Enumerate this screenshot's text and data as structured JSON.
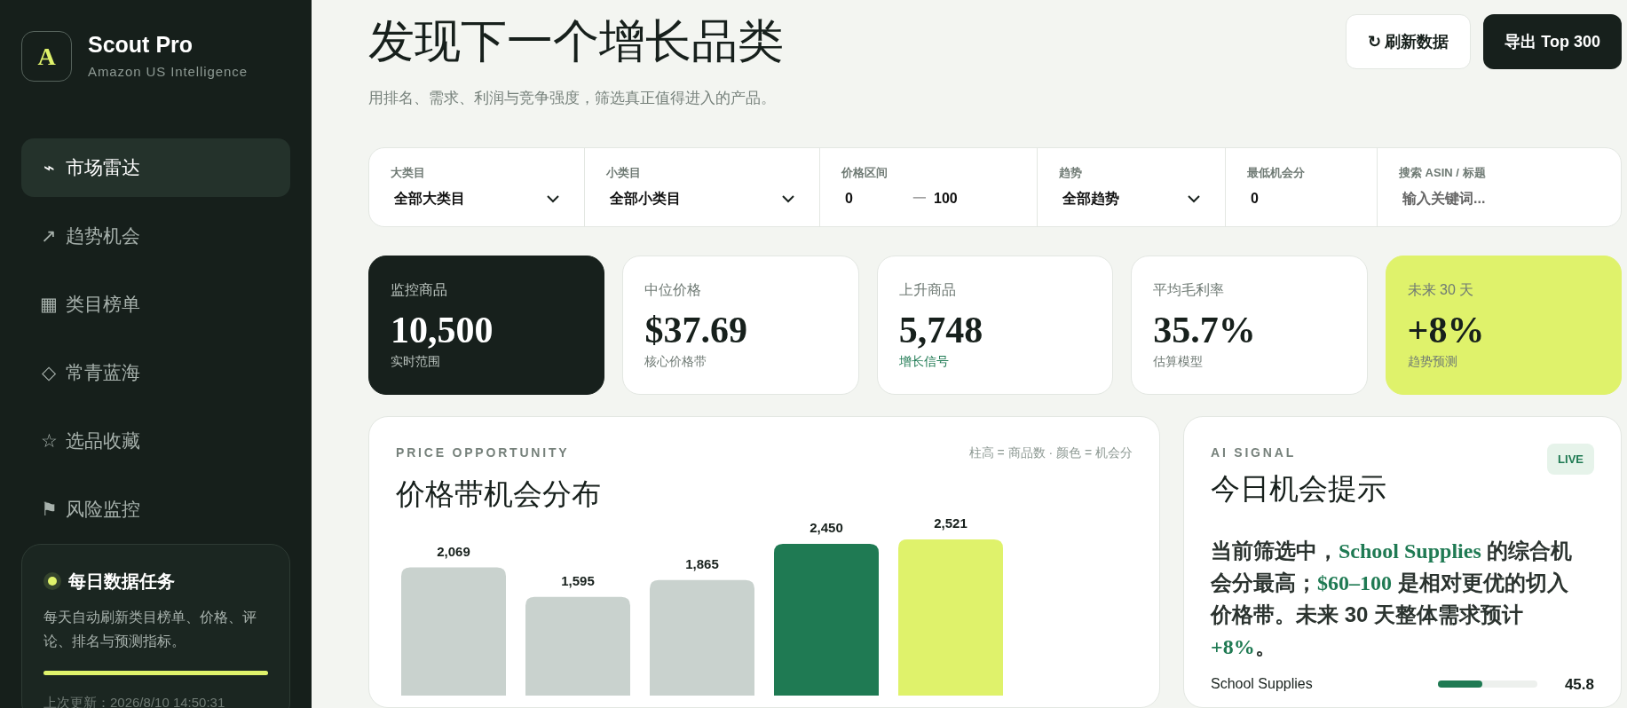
{
  "brand": {
    "logo": "A",
    "name": "Scout Pro",
    "tagline": "Amazon US Intelligence"
  },
  "nav": [
    {
      "icon": "⌁",
      "label": "市场雷达",
      "selected": true
    },
    {
      "icon": "↗",
      "label": "趋势机会",
      "selected": false
    },
    {
      "icon": "▦",
      "label": "类目榜单",
      "selected": false
    },
    {
      "icon": "◇",
      "label": "常青蓝海",
      "selected": false
    },
    {
      "icon": "☆",
      "label": "选品收藏",
      "selected": false
    },
    {
      "icon": "⚑",
      "label": "风险监控",
      "selected": false
    }
  ],
  "task": {
    "title": "每日数据任务",
    "description": "每天自动刷新类目榜单、价格、评论、排名与预测指标。",
    "level": 1,
    "updated": "上次更新：2026/8/10 14:50:31"
  },
  "header": {
    "title": "发现下一个增长品类",
    "subtitle": "用排名、需求、利润与竞争强度，筛选真正值得进入的产品。",
    "buttons": [
      {
        "kind": "secondary",
        "icon": "↻",
        "label": "刷新数据"
      },
      {
        "kind": "primary",
        "label": "导出 Top 300"
      }
    ]
  },
  "filters": [
    {
      "kind": "select",
      "label": "大类目",
      "value": "全部大类目"
    },
    {
      "kind": "select",
      "label": "小类目",
      "value": "全部小类目"
    },
    {
      "kind": "range",
      "label": "价格区间",
      "min": "0",
      "separator": "一",
      "max": "100"
    },
    {
      "kind": "select",
      "label": "趋势",
      "value": "全部趋势"
    },
    {
      "kind": "number",
      "label": "最低机会分",
      "value": "0"
    },
    {
      "kind": "search",
      "label": "搜索 ASIN / 标题",
      "placeholder": "输入关键词..."
    }
  ],
  "metrics": [
    {
      "kind": "dark",
      "label": "监控商品",
      "value": "10,500",
      "note": "实时范围",
      "note_positive": false
    },
    {
      "kind": "light",
      "label": "中位价格",
      "value": "$37.69",
      "note": "核心价格带",
      "note_positive": false
    },
    {
      "kind": "light",
      "label": "上升商品",
      "value": "5,748",
      "note": "增长信号",
      "note_positive": true
    },
    {
      "kind": "light",
      "label": "平均毛利率",
      "value": "35.7%",
      "note": "估算模型",
      "note_positive": false
    },
    {
      "kind": "accent",
      "label": "未来 30 天",
      "value": "+8%",
      "note": "趋势预测",
      "note_positive": false
    }
  ],
  "price_panel": {
    "eyebrow": "PRICE OPPORTUNITY",
    "legend": "柱高 = 商品数 · 颜色 = 机会分",
    "title": "价格带机会分布",
    "chart_data": {
      "type": "bar",
      "values": [
        2069,
        1595,
        1865,
        2450,
        2521
      ],
      "colors": [
        "#c9d2ce",
        "#c9d2ce",
        "#c9d2ce",
        "#1f7a53",
        "#dff26b"
      ],
      "value_labels": [
        "2,069",
        "1,595",
        "1,865",
        "2,450",
        "2,521"
      ],
      "data_labels": true
    }
  },
  "signal_panel": {
    "eyebrow": "AI SIGNAL",
    "badge": "LIVE",
    "title": "今日机会提示",
    "segments": [
      {
        "text": "当前筛选中，",
        "highlight": false
      },
      {
        "text": "School Supplies",
        "highlight": true
      },
      {
        "text": " 的综合机会分最高；",
        "highlight": false
      },
      {
        "text": "$60–100",
        "highlight": true
      },
      {
        "text": " 是相对更优的切入价格带。未来 30 天整体需求预计 ",
        "highlight": false
      },
      {
        "text": "+8%",
        "highlight": true
      },
      {
        "text": "。",
        "highlight": false
      }
    ],
    "scores": [
      {
        "name": "School Supplies",
        "level": 0.45,
        "value": "45.8"
      }
    ]
  }
}
